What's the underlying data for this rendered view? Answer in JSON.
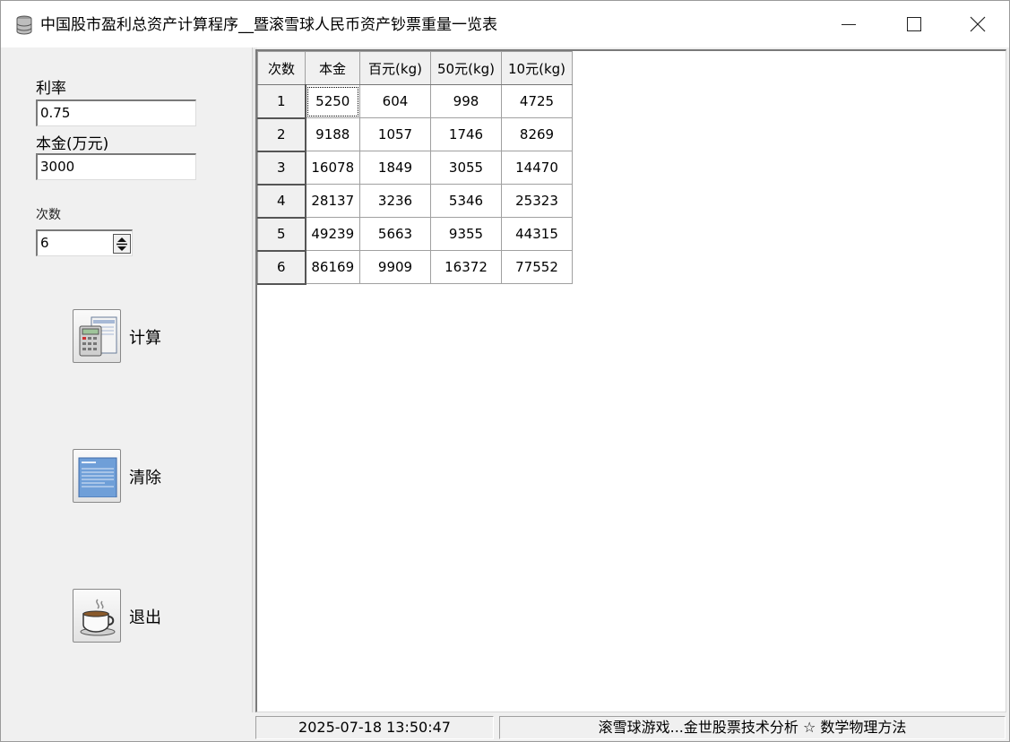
{
  "window": {
    "title": "中国股市盈利总资产计算程序__暨滚雪球人民币资产钞票重量一览表",
    "app_icon": "database-icon",
    "controls": [
      "minimize-icon",
      "maximize-icon",
      "close-icon"
    ]
  },
  "form": {
    "rate_label": "利率",
    "rate_value": "0.75",
    "principal_label": "本金(万元)",
    "principal_value": "3000",
    "times_label": "次数",
    "times_value": "6"
  },
  "buttons": {
    "calculate": {
      "label": "计算",
      "icon": "calculator-icon"
    },
    "clear": {
      "label": "清除",
      "icon": "document-icon"
    },
    "exit": {
      "label": "退出",
      "icon": "coffee-cup-icon"
    }
  },
  "grid": {
    "columns": [
      "次数",
      "本金",
      "百元(kg)",
      "50元(kg)",
      "10元(kg)"
    ],
    "rows": [
      [
        "1",
        "5250",
        "604",
        "998",
        "4725"
      ],
      [
        "2",
        "9188",
        "1057",
        "1746",
        "8269"
      ],
      [
        "3",
        "16078",
        "1849",
        "3055",
        "14470"
      ],
      [
        "4",
        "28137",
        "3236",
        "5346",
        "25323"
      ],
      [
        "5",
        "49239",
        "5663",
        "9355",
        "44315"
      ],
      [
        "6",
        "86169",
        "9909",
        "16372",
        "77552"
      ]
    ]
  },
  "status": {
    "datetime": "2025-07-18 13:50:47",
    "message": "滚雪球游戏...金世股票技术分析 ☆ 数学物理方法"
  },
  "colors": {
    "window_bg": "#f0f0f0",
    "grid_bg": "#ffffff",
    "title_bg": "#ffffff"
  }
}
